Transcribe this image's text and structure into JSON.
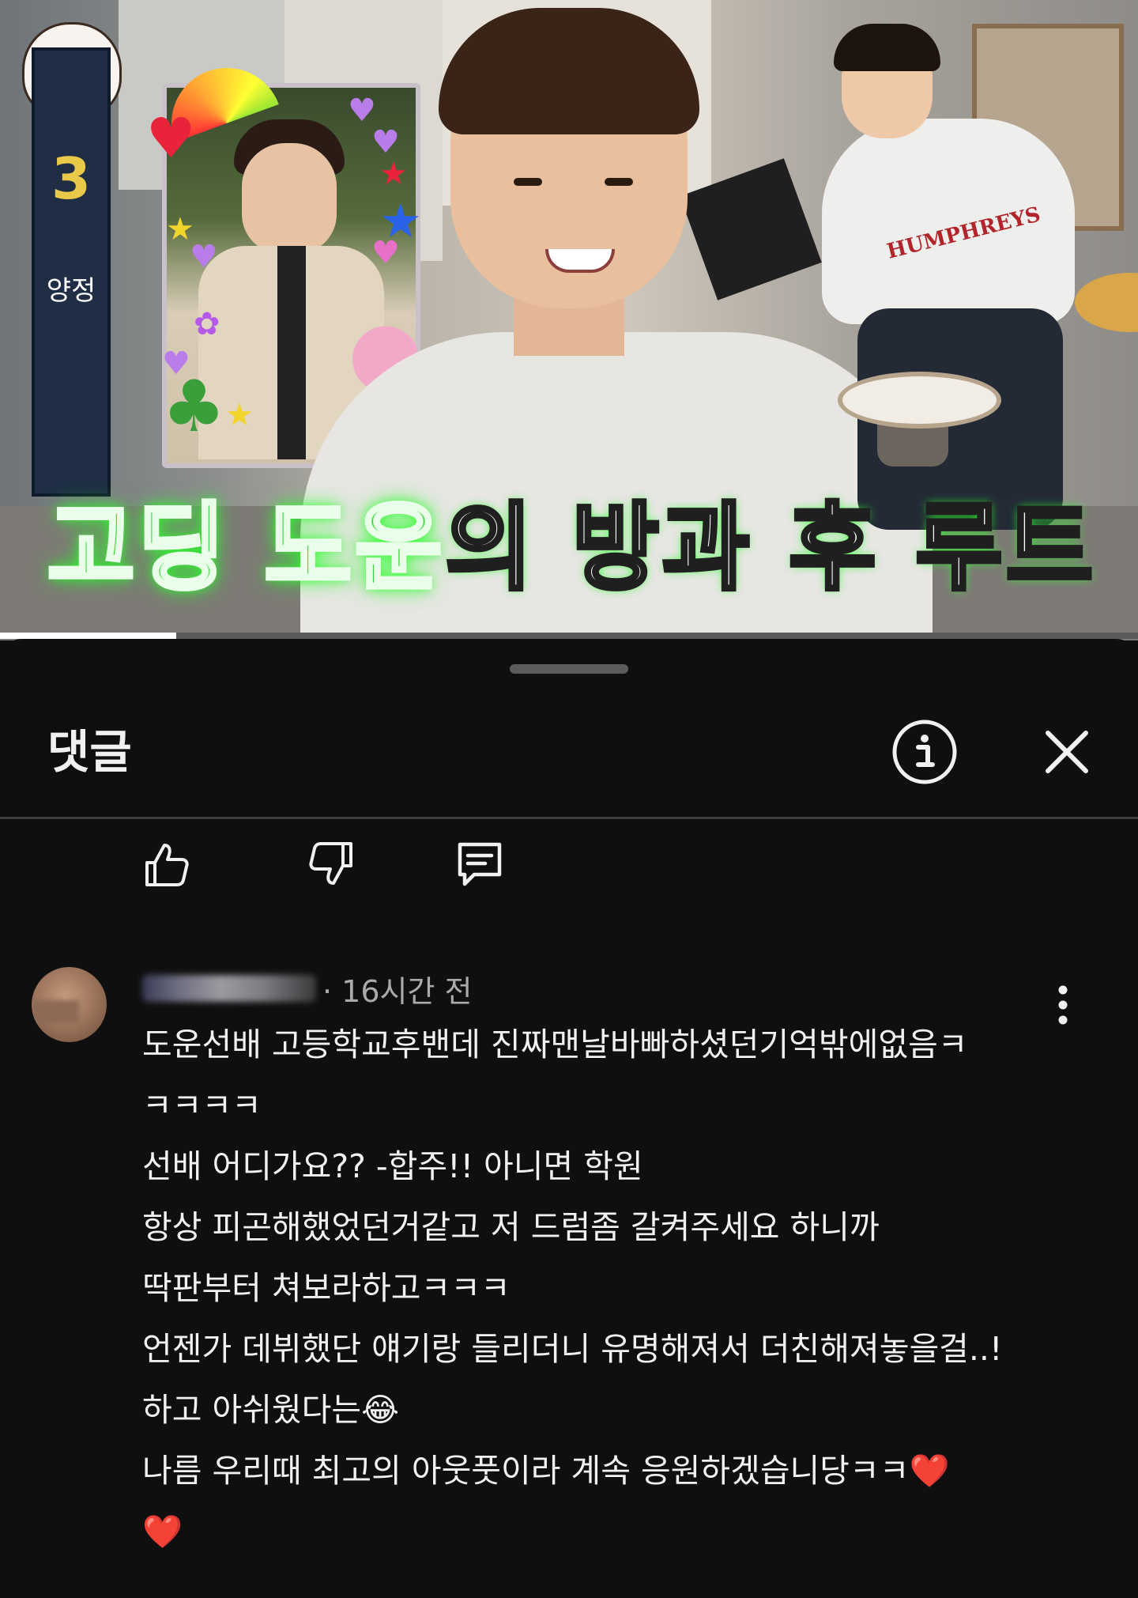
{
  "video": {
    "caption_green": "고딩 도운",
    "caption_white": "의 방과 후 루트",
    "sign_number": "3",
    "sign_text": "양정",
    "drummer_logo": "HUMPHREYS",
    "progress": 0.155
  },
  "sheet": {
    "title": "댓글",
    "info_icon": "info-icon",
    "close_icon": "close-icon"
  },
  "actions": {
    "like_icon": "thumbs-up-icon",
    "dislike_icon": "thumbs-down-icon",
    "reply_icon": "reply-icon"
  },
  "comment": {
    "time": "· 16시간 전",
    "lines": [
      "도운선배 고등학교후밴데 진짜맨날바빠하셨던기억밖에없음ㅋ",
      "ㅋㅋㅋㅋ",
      "선배 어디가요?? -합주!! 아니면 학원",
      "항상 피곤해했었던거같고 저 드럼좀 갈켜주세요 하니까",
      "딱판부터 쳐보라하고ㅋㅋㅋ",
      "언젠가 데뷔했단 얘기랑 들리더니 유명해져서 더친해져놓을걸..!",
      "하고 아쉬웠다는😂",
      "나름 우리때 최고의 아웃풋이라 계속 응원하겠습니당ㅋㅋ❤️",
      "❤️"
    ]
  },
  "colors": {
    "background": "#0f0f0f",
    "text": "#f1f1f1",
    "secondary_text": "#aaaaaa",
    "caption_green": "#3bd63b"
  }
}
